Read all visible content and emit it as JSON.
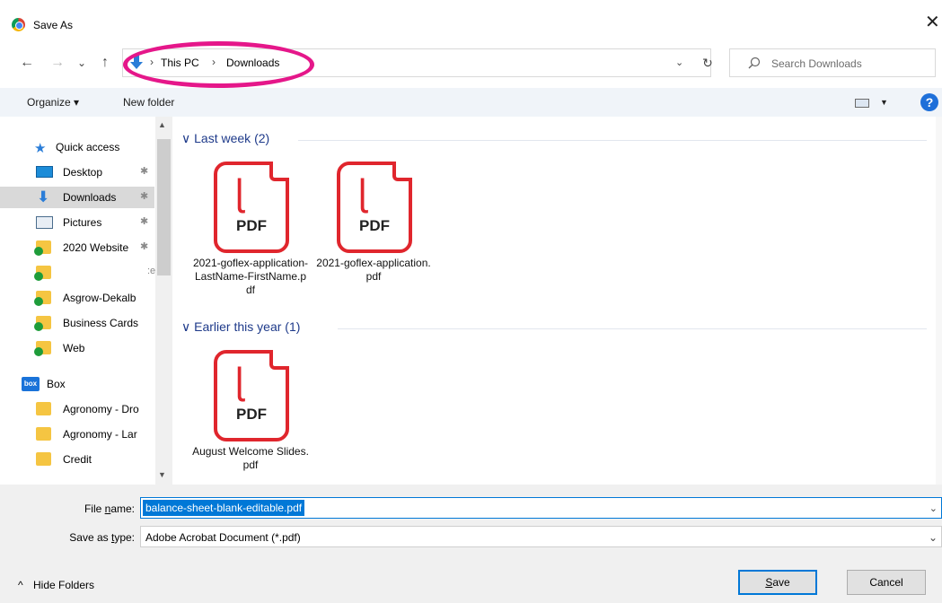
{
  "window": {
    "title": "Save As",
    "close_glyph": "✕"
  },
  "nav": {
    "back": "←",
    "forward": "→",
    "recent": "⌄",
    "up": "↑"
  },
  "breadcrumbs": [
    "This PC",
    "Downloads"
  ],
  "breadcrumb_sep": "›",
  "address_dropdown": "⌄",
  "refresh": "↻",
  "search": {
    "placeholder": "Search Downloads",
    "icon": "search-icon"
  },
  "toolbar": {
    "organize": "Organize ▾",
    "new_folder": "New folder",
    "help": "?"
  },
  "sidebar": {
    "quick_access": "Quick access",
    "items": [
      {
        "label": "Desktop",
        "pinned": true,
        "icon": "desktop-icon"
      },
      {
        "label": "Downloads",
        "pinned": true,
        "icon": "downloads-icon",
        "selected": true
      },
      {
        "label": "Pictures",
        "pinned": true,
        "icon": "pictures-icon"
      },
      {
        "label": "2020 Website",
        "pinned": true,
        "icon": "folder-icon"
      },
      {
        "label": "",
        "icon": "folder-icon"
      },
      {
        "label": "Asgrow-Dekalb",
        "icon": "folder-icon"
      },
      {
        "label": "Business Cards",
        "icon": "folder-icon"
      },
      {
        "label": "Web",
        "icon": "folder-icon"
      }
    ],
    "box": "Box",
    "box_items": [
      {
        "label": "Agronomy - Dro"
      },
      {
        "label": "Agronomy - Lar"
      },
      {
        "label": "Credit"
      }
    ],
    "pin_glyph": "✱",
    "truncated_glyph": ":e"
  },
  "groups": [
    {
      "header": "Last week (2)",
      "files": [
        {
          "name": "2021-goflex-application-LastName-FirstName.pdf",
          "type_label": "PDF"
        },
        {
          "name": "2021-goflex-application.pdf",
          "type_label": "PDF"
        }
      ]
    },
    {
      "header": "Earlier this year (1)",
      "files": [
        {
          "name": "August Welcome Slides.pdf",
          "type_label": "PDF"
        }
      ]
    }
  ],
  "group_chevron": "∨",
  "form": {
    "file_name_label_pre": "File ",
    "file_name_label_u": "n",
    "file_name_label_post": "ame:",
    "file_name_value": "balance-sheet-blank-editable.pdf",
    "save_as_type_label_pre": "Save as ",
    "save_as_type_label_u": "t",
    "save_as_type_label_post": "ype:",
    "save_as_type_value": "Adobe Acrobat Document (*.pdf)",
    "dropdown_glyph": "⌄"
  },
  "footer": {
    "hide_folders": "Hide Folders",
    "hide_glyph": "^",
    "save_u": "S",
    "save_rest": "ave",
    "cancel": "Cancel"
  },
  "colors": {
    "accent": "#0078d7",
    "highlight_ring": "#e5178a",
    "pdf_red": "#e0262d",
    "group_header": "#1e3a8a"
  }
}
